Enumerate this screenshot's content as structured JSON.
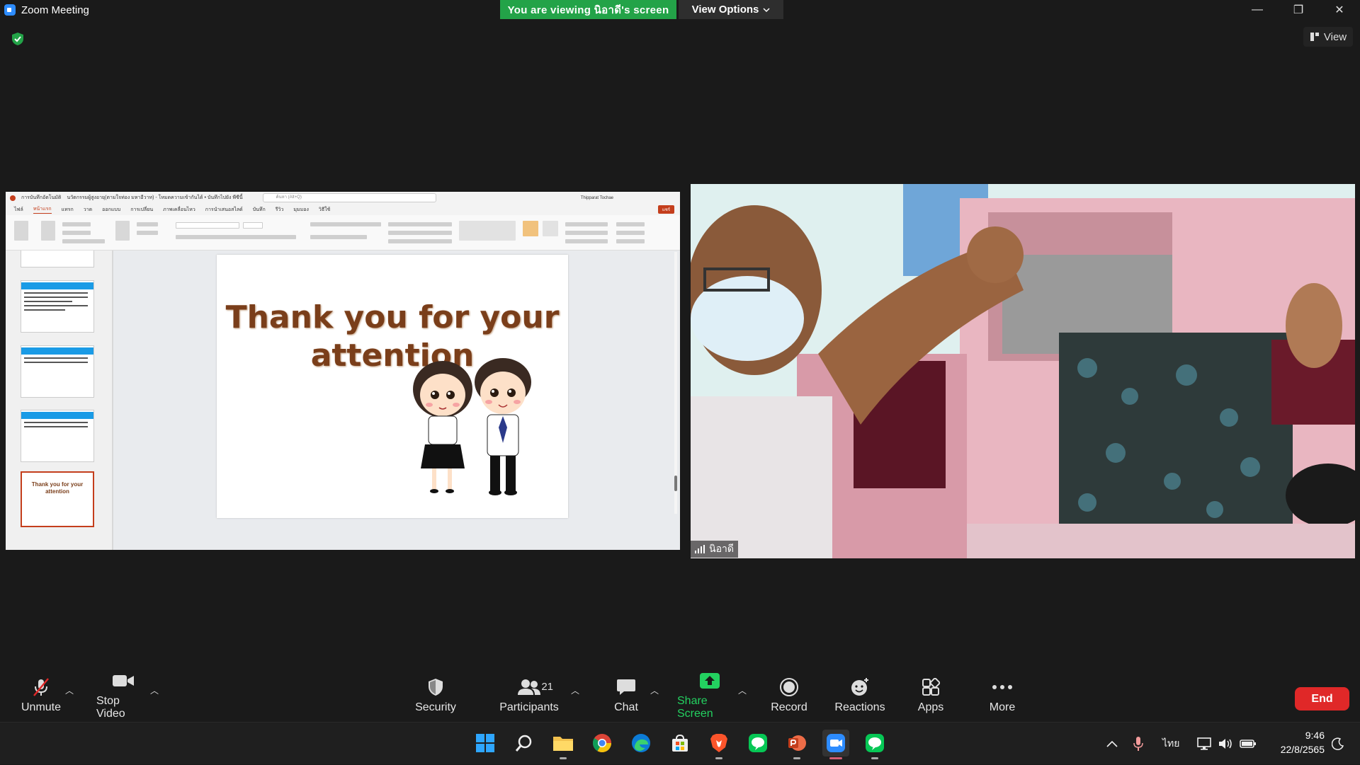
{
  "window": {
    "title": "Zoom Meeting",
    "controls": [
      "—",
      "❐",
      "✕"
    ]
  },
  "banner": {
    "viewing_text": "You are viewing นิอาดี's screen",
    "view_options": "View Options",
    "view_button": "View"
  },
  "ppt": {
    "title_text": "การบันทึกอัตโนมัติ",
    "doc_name": "นวัตกรรมผู้สูงอายุ(ตามใจท่อง มหาอีวาท) - โหมดความเข้ากันได้ • บันทึกไปยัง พีซีนี้",
    "search_placeholder": "ค้นหา (Alt+Q)",
    "user": "Thipparat Tochae",
    "tabs": [
      "ไฟล์",
      "หน้าแรก",
      "แทรก",
      "วาด",
      "ออกแบบ",
      "การเปลี่ยน",
      "ภาพเคลื่อนไหว",
      "การนำเสนอสไลด์",
      "บันทึก",
      "รีวิว",
      "มุมมอง",
      "วิธีใช้"
    ],
    "share": "แชร์",
    "thumb_last_text": "Thank you for your attention"
  },
  "slide": {
    "line1": "Thank you for your",
    "line2": "attention"
  },
  "participant": {
    "name": "นิอาดี"
  },
  "toolbar": {
    "unmute": "Unmute",
    "stop_video": "Stop Video",
    "security": "Security",
    "participants": "Participants",
    "participants_count": "21",
    "chat": "Chat",
    "share_screen": "Share Screen",
    "record": "Record",
    "reactions": "Reactions",
    "apps": "Apps",
    "more": "More",
    "end": "End"
  },
  "taskbar": {
    "language": "ไทย",
    "time": "9:46",
    "date": "22/8/2565"
  },
  "colors": {
    "share_green": "#23d160",
    "banner_green": "#23a348",
    "end_red": "#e02828",
    "accent_blue": "#2d8cff"
  }
}
